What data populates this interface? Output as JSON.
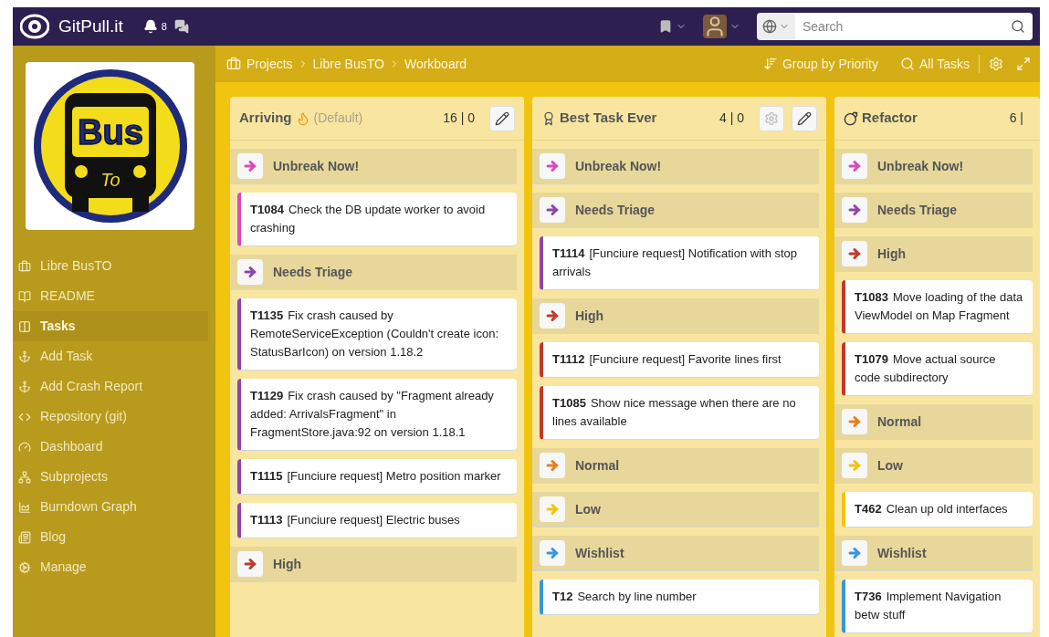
{
  "topbar": {
    "brand": "GitPull.it",
    "notifications": "8",
    "search": {
      "placeholder": "Search"
    }
  },
  "logo": {
    "text": "Bus",
    "sub": "To"
  },
  "sidebar": {
    "items": [
      {
        "label": "Libre BusTO",
        "selected": false
      },
      {
        "label": "README",
        "selected": false
      },
      {
        "label": "Tasks",
        "selected": true
      },
      {
        "label": "Add Task",
        "selected": false
      },
      {
        "label": "Add Crash Report",
        "selected": false
      },
      {
        "label": "Repository (git)",
        "selected": false
      },
      {
        "label": "Dashboard",
        "selected": false
      },
      {
        "label": "Subprojects",
        "selected": false
      },
      {
        "label": "Burndown Graph",
        "selected": false
      },
      {
        "label": "Blog",
        "selected": false
      },
      {
        "label": "Manage",
        "selected": false
      }
    ]
  },
  "breadcrumb": [
    "Projects",
    "Libre BusTO",
    "Workboard"
  ],
  "actions": {
    "group": "Group by Priority",
    "filter": "All Tasks"
  },
  "columns": [
    {
      "kind": "fire",
      "title": "Arriving",
      "note": "(Default)",
      "count": "16 | 0",
      "edit_button": true,
      "lanes": [
        {
          "label": "Unbreak Now!",
          "color": "#da49be",
          "cards": [
            {
              "id": "T1084",
              "text": "Check the DB update worker to avoid crashing"
            }
          ]
        },
        {
          "label": "Needs Triage",
          "color": "#8e44ad",
          "cards": [
            {
              "id": "T1135",
              "text": "Fix crash caused by RemoteServiceException (Couldn't create icon: StatusBarIcon) on version 1.18.2"
            },
            {
              "id": "T1129",
              "text": "Fix crash caused by \"Fragment already added: ArrivalsFragment\" in FragmentStore.java:92 on version 1.18.1"
            },
            {
              "id": "T1115",
              "text": "[Funciure request] Metro position marker"
            },
            {
              "id": "T1113",
              "text": "[Funciure request] Electric buses"
            }
          ]
        },
        {
          "label": "High",
          "color": "#c0392b"
        }
      ]
    },
    {
      "kind": "top",
      "title": "Best Task Ever",
      "count": "4 | 0",
      "settings_button": true,
      "edit_button": true,
      "lanes": [
        {
          "label": "Unbreak Now!",
          "color": "#da49be"
        },
        {
          "label": "Needs Triage",
          "color": "#8e44ad",
          "cards": [
            {
              "id": "T1114",
              "text": "[Funciure request] Notification with stop arrivals"
            }
          ]
        },
        {
          "label": "High",
          "color": "#c0392b",
          "cards": [
            {
              "id": "T1112",
              "text": "[Funciure request] Favorite lines first"
            },
            {
              "id": "T1085",
              "text": "Show nice message when there are no lines available"
            }
          ]
        },
        {
          "label": "Normal",
          "color": "#e67e22"
        },
        {
          "label": "Low",
          "color": "#f1c40f"
        },
        {
          "label": "Wishlist",
          "color": "#3498db",
          "cards": [
            {
              "id": "T12",
              "text": "Search by line number"
            }
          ]
        }
      ]
    },
    {
      "kind": "bomb",
      "title": "Refactor",
      "count": "6 |",
      "lanes": [
        {
          "label": "Unbreak Now!",
          "color": "#da49be"
        },
        {
          "label": "Needs Triage",
          "color": "#8e44ad"
        },
        {
          "label": "High",
          "color": "#c0392b",
          "cards": [
            {
              "id": "T1083",
              "text": "Move loading of the data ViewModel on Map Fragment"
            },
            {
              "id": "T1079",
              "text": "Move actual source code subdirectory"
            }
          ]
        },
        {
          "label": "Normal",
          "color": "#e67e22"
        },
        {
          "label": "Low",
          "color": "#f1c40f",
          "cards": [
            {
              "id": "T462",
              "text": "Clean up old interfaces"
            }
          ]
        },
        {
          "label": "Wishlist",
          "color": "#3498db",
          "cards": [
            {
              "id": "T736",
              "text": "Implement Navigation betw stuff"
            }
          ]
        }
      ]
    }
  ]
}
